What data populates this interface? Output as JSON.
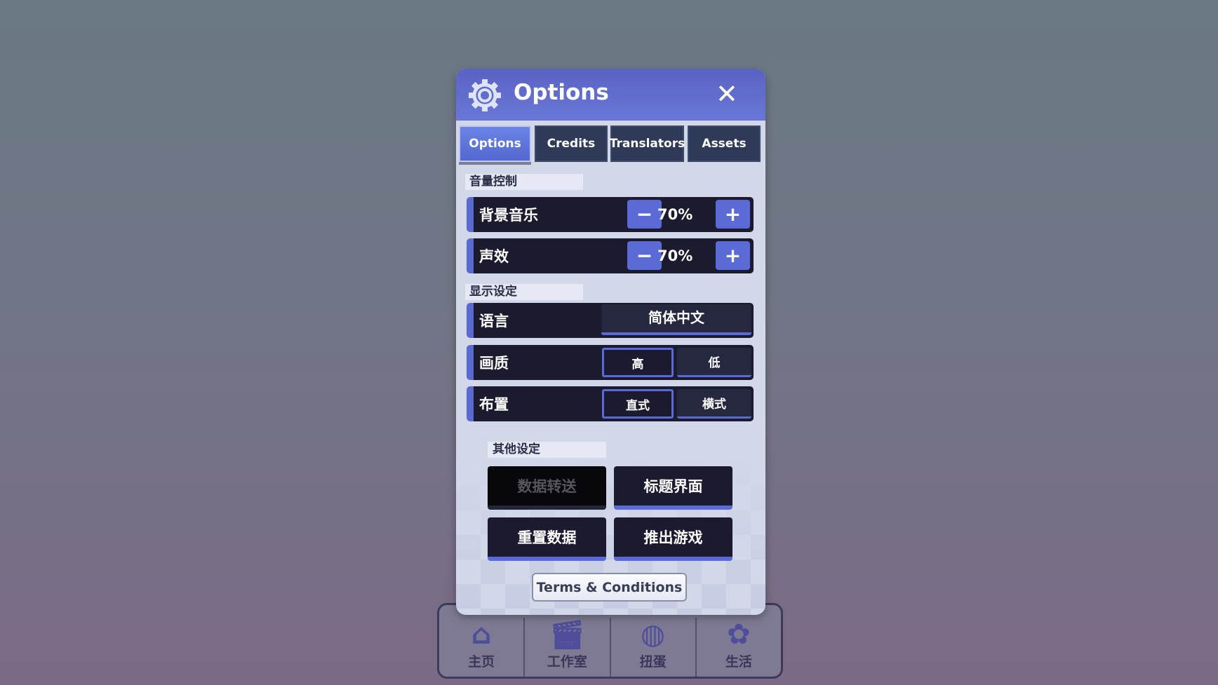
{
  "dialog": {
    "title": "Options",
    "close_icon": "close-icon",
    "gear_icon": "gear-icon"
  },
  "tabs": [
    {
      "label": "Options",
      "active": true
    },
    {
      "label": "Credits"
    },
    {
      "label": "Translators"
    },
    {
      "label": "Assets"
    }
  ],
  "volume": {
    "section": "音量控制",
    "bgm": {
      "label": "背景音乐",
      "value": "70%"
    },
    "sfx": {
      "label": "声效",
      "value": "70%"
    },
    "minus": "−",
    "plus": "+"
  },
  "display": {
    "section": "显示设定",
    "language": {
      "label": "语言",
      "value": "简体中文"
    },
    "quality": {
      "label": "画质",
      "options": [
        "高",
        "低"
      ],
      "selected": "高"
    },
    "layout": {
      "label": "布置",
      "options": [
        "直式",
        "横式"
      ],
      "selected": "直式"
    }
  },
  "other": {
    "section": "其他设定",
    "buttons": [
      "数据转送",
      "标题界面",
      "重置数据",
      "推出游戏"
    ],
    "disabled": "数据转送"
  },
  "terms": "Terms & Conditions",
  "nav": [
    {
      "label": "主页",
      "icon": "house-icon"
    },
    {
      "label": "工作室",
      "icon": "clapperboard-icon"
    },
    {
      "label": "扭蛋",
      "icon": "gacha-ball-icon"
    },
    {
      "label": "生活",
      "icon": "flower-icon"
    }
  ],
  "colors": {
    "accent": "#5a6ad6",
    "header": "#6270d0",
    "row": "#1c1a2e"
  }
}
